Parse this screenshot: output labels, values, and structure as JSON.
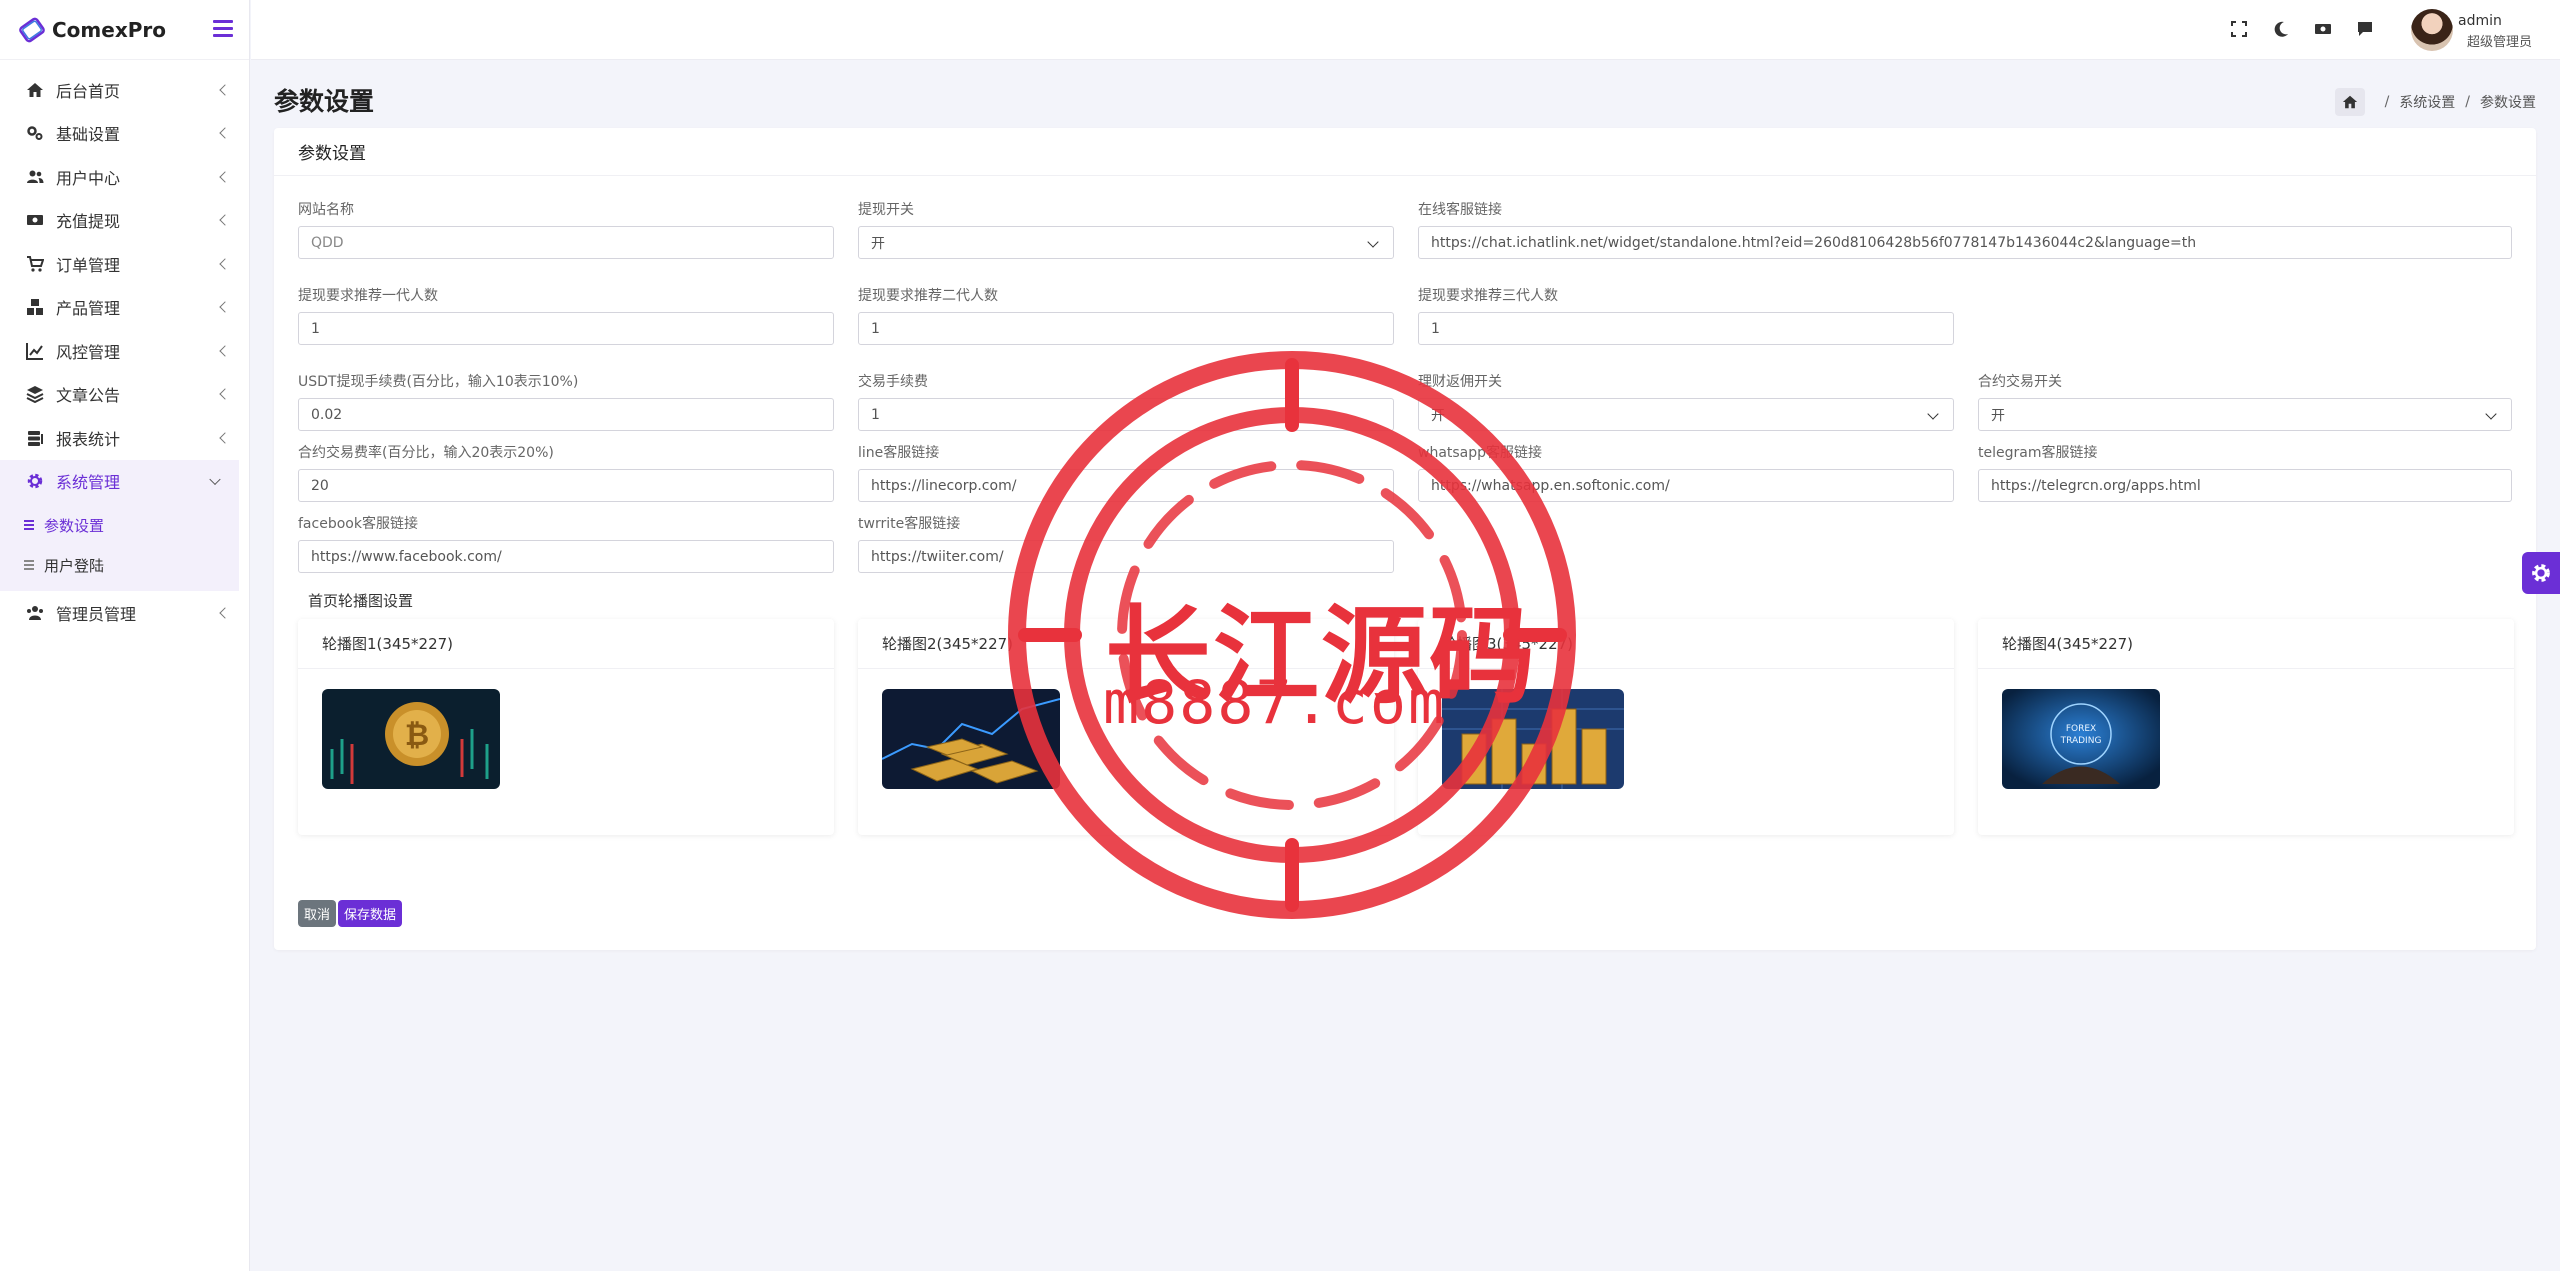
{
  "app": {
    "brand": "ComexPro"
  },
  "sidebar": {
    "items": [
      {
        "label": "后台首页",
        "icon": "home-icon"
      },
      {
        "label": "基础设置",
        "icon": "gears-icon"
      },
      {
        "label": "用户中心",
        "icon": "users-icon"
      },
      {
        "label": "充值提现",
        "icon": "money-icon"
      },
      {
        "label": "订单管理",
        "icon": "cart-icon"
      },
      {
        "label": "产品管理",
        "icon": "cubes-icon"
      },
      {
        "label": "风控管理",
        "icon": "chart-line-icon"
      },
      {
        "label": "文章公告",
        "icon": "layers-icon"
      },
      {
        "label": "报表统计",
        "icon": "database-icon"
      },
      {
        "label": "系统管理",
        "icon": "gear-icon",
        "active": true
      },
      {
        "label": "管理员管理",
        "icon": "user-group-icon"
      }
    ],
    "sub_items": [
      {
        "label": "参数设置",
        "active": true
      },
      {
        "label": "用户登陆"
      }
    ]
  },
  "topbar": {
    "user_name": "admin",
    "user_role": "超级管理员"
  },
  "page": {
    "title": "参数设置",
    "breadcrumb": [
      "系统设置",
      "参数设置"
    ]
  },
  "card": {
    "title": "参数设置",
    "fields": {
      "site_name": {
        "label": "网站名称",
        "value": "QDD"
      },
      "withdraw_switch": {
        "label": "提现开关",
        "value": "开"
      },
      "cs_link": {
        "label": "在线客服链接",
        "value": "https://chat.ichatlink.net/widget/standalone.html?eid=260d8106428b56f0778147b1436044c2&language=th"
      },
      "ref1": {
        "label": "提现要求推荐一代人数",
        "value": "1"
      },
      "ref2": {
        "label": "提现要求推荐二代人数",
        "value": "1"
      },
      "ref3": {
        "label": "提现要求推荐三代人数",
        "value": "1"
      },
      "usdt_fee": {
        "label": "USDT提现手续费(百分比，输入10表示10%)",
        "value": "0.02"
      },
      "trade_fee": {
        "label": "交易手续费",
        "value": "1"
      },
      "rebate_switch": {
        "label": "理财返佣开关",
        "value": "开"
      },
      "contract_switch": {
        "label": "合约交易开关",
        "value": "开"
      },
      "contract_rate": {
        "label": "合约交易费率(百分比，输入20表示20%)",
        "value": "20"
      },
      "line_link": {
        "label": "line客服链接",
        "value": "https://linecorp.com/"
      },
      "whatsapp_link": {
        "label": "whatsapp客服链接",
        "value": "https://whatsapp.en.softonic.com/"
      },
      "telegram_link": {
        "label": "telegram客服链接",
        "value": "https://telegrcn.org/apps.html"
      },
      "facebook_link": {
        "label": "facebook客服链接",
        "value": "https://www.facebook.com/"
      },
      "twitter_link": {
        "label": "twrrite客服链接",
        "value": "https://twiiter.com/"
      }
    },
    "carousel_title": "首页轮播图设置",
    "carousel": [
      {
        "label": "轮播图1(345*227)"
      },
      {
        "label": "轮播图2(345*227)"
      },
      {
        "label": "轮播图3(345*227)"
      },
      {
        "label": "轮播图4(345*227)",
        "image_text": "FOREX TRADING"
      }
    ],
    "buttons": {
      "cancel": "取消",
      "save": "保存数据"
    }
  },
  "watermark": {
    "line1": "长江源码",
    "line2": "m8887.com"
  },
  "colors": {
    "accent": "#6b2fd6",
    "watermark": "#e8323c"
  }
}
